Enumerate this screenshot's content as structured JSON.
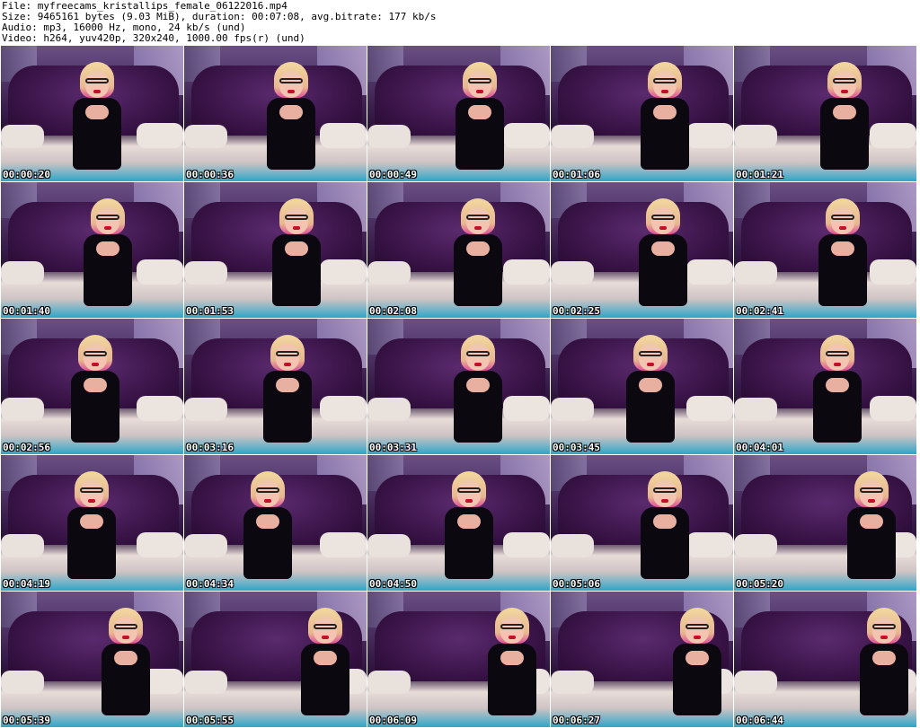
{
  "header": {
    "file_line": "File: myfreecams_kristallips_female_06122016.mp4",
    "size_line": "Size: 9465161 bytes (9.03 MiB), duration: 00:07:08, avg.bitrate: 177 kb/s",
    "audio_line": "Audio: mp3, 16000 Hz, mono, 24 kb/s (und)",
    "video_line": "Video: h264, yuv420p, 320x240, 1000.00 fps(r) (und)"
  },
  "thumbnails": [
    {
      "time": "00:00:20"
    },
    {
      "time": "00:00:36"
    },
    {
      "time": "00:00:49"
    },
    {
      "time": "00:01:06"
    },
    {
      "time": "00:01:21"
    },
    {
      "time": "00:01:40"
    },
    {
      "time": "00:01:53"
    },
    {
      "time": "00:02:08"
    },
    {
      "time": "00:02:25"
    },
    {
      "time": "00:02:41"
    },
    {
      "time": "00:02:56"
    },
    {
      "time": "00:03:16"
    },
    {
      "time": "00:03:31"
    },
    {
      "time": "00:03:45"
    },
    {
      "time": "00:04:01"
    },
    {
      "time": "00:04:19"
    },
    {
      "time": "00:04:34"
    },
    {
      "time": "00:04:50"
    },
    {
      "time": "00:05:06"
    },
    {
      "time": "00:05:20"
    },
    {
      "time": "00:05:39"
    },
    {
      "time": "00:05:55"
    },
    {
      "time": "00:06:09"
    },
    {
      "time": "00:06:27"
    },
    {
      "time": "00:06:44"
    }
  ]
}
